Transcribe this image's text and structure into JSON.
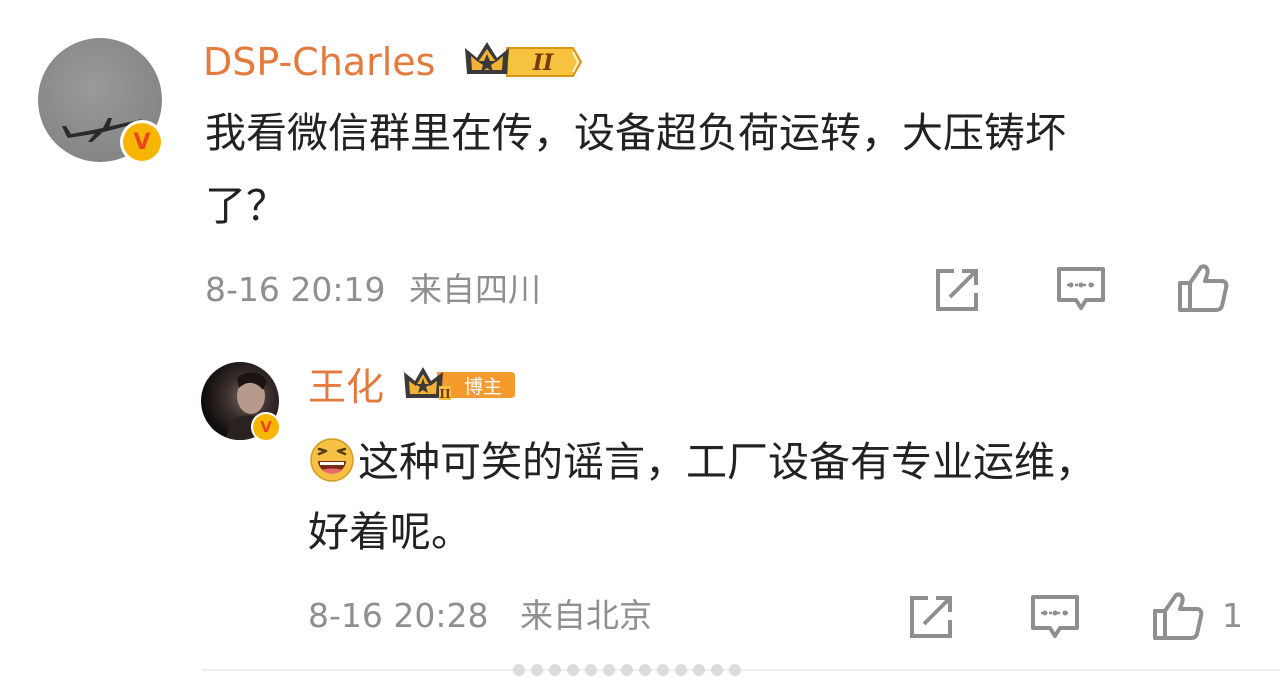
{
  "comments": [
    {
      "username": "DSP-Charles",
      "badge": {
        "level": "II",
        "icon": "crown-icon",
        "color": "#f0a71e"
      },
      "verified": "V",
      "text_lines": [
        "我看微信群里在传，设备超负荷运转，大压铸坏",
        "了？"
      ],
      "time": "8-16 20:19",
      "location": "来自四川"
    },
    {
      "username": "王化",
      "badge": {
        "level": "II",
        "icon": "crown-icon",
        "color": "#f0a71e",
        "role": "博主"
      },
      "verified": "V",
      "emoji": "laughing-emoji-icon",
      "text_lines": [
        "这种可笑的谣言，工厂设备有专业运维，",
        "好着呢。"
      ],
      "time": "8-16 20:28",
      "location": "来自北京",
      "like_count": "1"
    }
  ],
  "colors": {
    "accent": "#e47a3d",
    "meta": "#8f8f8f",
    "badge_gold": "#f7b500",
    "badge_v": "#e9471c"
  }
}
